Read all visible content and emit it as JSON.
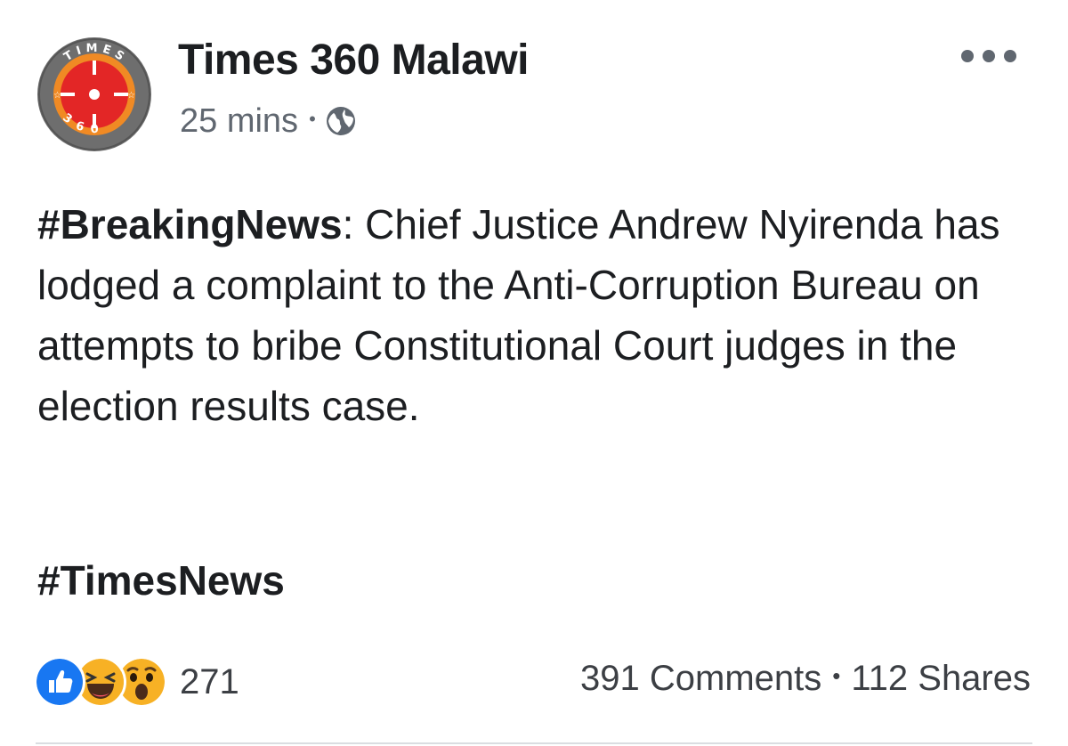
{
  "post": {
    "page_name": "Times 360 Malawi",
    "timestamp": "25 mins",
    "meta_separator": "•",
    "privacy_icon": "globe-icon",
    "more_icon": "more-options-icon",
    "logo": {
      "text_top": "TIMES",
      "text_bottom": "360",
      "colors": {
        "ring": "#6e6e6e",
        "outer": "#f08a24",
        "inner": "#e32626"
      }
    },
    "body": {
      "hashtag": "#BreakingNews",
      "text": ": Chief Justice Andrew Nyirenda has lodged a complaint to the Anti-Corruption Bureau on attempts to bribe Constitutional Court judges in the election results case."
    },
    "footer_hashtag": "#TimesNews",
    "reactions": {
      "icons": [
        "like-icon",
        "haha-icon",
        "wow-icon"
      ],
      "count": "271"
    },
    "stats": {
      "comments": "391 Comments",
      "separator": "•",
      "shares": "112 Shares"
    }
  },
  "colors": {
    "text": "#1c1e21",
    "meta": "#606770",
    "like_blue": "#1877f2",
    "emoji_yellow": "#f7b125"
  }
}
